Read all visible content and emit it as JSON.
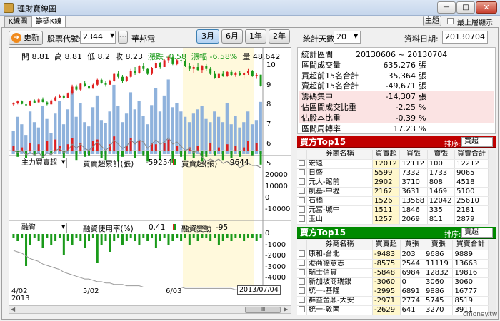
{
  "window": {
    "title": "理財寶線圖",
    "btn_theme": "主題",
    "always_on_top": "最上層顯示",
    "min": "—",
    "max": "□",
    "close": "✕"
  },
  "tabs": [
    "K線圖",
    "籌碼K線圖"
  ],
  "toolbar": {
    "refresh": "更新",
    "stock_code_label": "股票代號:",
    "stock_code": "2344",
    "stock_name": "華邦電",
    "periods": [
      "3月",
      "6月",
      "1年",
      "2年"
    ],
    "days_label": "統計天數:",
    "days_value": "20",
    "date_label": "資料日期:",
    "date_value": "20130704"
  },
  "ohlc": {
    "open_label": "開",
    "open": "8.81",
    "high_label": "高",
    "high": "8.81",
    "low_label": "低",
    "low": "8.2",
    "close_label": "收",
    "close": "8.23",
    "chg_label": "漲跌",
    "chg": "-0.58",
    "pct_label": "漲幅",
    "pct": "-6.58%",
    "vol_label": "量",
    "vol": "48,642"
  },
  "price_axis": [
    "10",
    "9",
    "8",
    "7",
    "6",
    "5"
  ],
  "panel2": {
    "select": "主力買賣超",
    "cum_label": "買賣超累計(張)",
    "cum_val": "-59254",
    "net_label": "買賣超(張)",
    "net_val": "-9644",
    "axis": [
      "20000",
      "10000",
      "0",
      "-10000"
    ]
  },
  "panel3": {
    "select": "融資",
    "use_label": "融資使用率(%)",
    "use_val": "0.41",
    "chg_label": "融資變動",
    "chg_val": "-95",
    "axis": [
      "0",
      "-1000",
      "-2000",
      "-3000",
      "-4000"
    ]
  },
  "xaxis": {
    "labels": [
      "4/02",
      "5/02",
      "6/03"
    ],
    "year": "2013",
    "cursor": "2013/07/04"
  },
  "stats": [
    {
      "label": "統計區間",
      "value": "20130606 ~ 20130704",
      "unit": ""
    },
    {
      "label": "區間成交量",
      "value": "635,276",
      "unit": "張"
    },
    {
      "label": "買超前15名合計",
      "value": "35,364",
      "unit": "張"
    },
    {
      "label": "賣超前15名合計",
      "value": "-49,671",
      "unit": "張"
    },
    {
      "label": "籌碼集中",
      "value": "-14,307",
      "unit": "張"
    },
    {
      "label": "佔區間成交比重",
      "value": "-2.25",
      "unit": "%"
    },
    {
      "label": "佔股本比重",
      "value": "-0.39",
      "unit": "%"
    },
    {
      "label": "區間周轉率",
      "value": "17.23",
      "unit": "%"
    }
  ],
  "buy_panel": {
    "title": "買方Top15",
    "sort_label": "排序:",
    "sort_value": "買超",
    "headers": [
      "券商名稱",
      "買賣超",
      "買張",
      "賣張",
      "買賣合計"
    ],
    "rows": [
      [
        "宏遠",
        "12012",
        "12112",
        "100",
        "12212"
      ],
      [
        "日盛",
        "5599",
        "7332",
        "1733",
        "9065"
      ],
      [
        "元大-館前",
        "2902",
        "3710",
        "808",
        "4518"
      ],
      [
        "凱基-中壢",
        "2162",
        "3631",
        "1469",
        "5100"
      ],
      [
        "石橋",
        "1526",
        "13568",
        "12042",
        "25610"
      ],
      [
        "元富-城中",
        "1511",
        "1846",
        "335",
        "2181"
      ],
      [
        "玉山",
        "1257",
        "2069",
        "811",
        "2879"
      ]
    ]
  },
  "sell_panel": {
    "title": "賣方Top15",
    "sort_label": "排序:",
    "sort_value": "賣超",
    "headers": [
      "券商名稱",
      "買賣超",
      "買張",
      "賣張",
      "買賣合計"
    ],
    "rows": [
      [
        "康和-台北",
        "-9483",
        "203",
        "9686",
        "9889"
      ],
      [
        "港商德意志",
        "-8575",
        "2544",
        "11119",
        "13663"
      ],
      [
        "瑞士信貸",
        "-5848",
        "6984",
        "12832",
        "19816"
      ],
      [
        "新加坡商瑞銀",
        "-3060",
        "0",
        "3060",
        "3060"
      ],
      [
        "統一-基隆",
        "-2995",
        "6891",
        "9886",
        "16777"
      ],
      [
        "群益金鼎-大安",
        "-2971",
        "2774",
        "5745",
        "8519"
      ],
      [
        "統一-敦南",
        "-2629",
        "641",
        "3270",
        "3911"
      ]
    ]
  },
  "watermark": "cmoney.tw",
  "colors": {
    "up": "#e02020",
    "down": "#1a9a1a",
    "bar": "#8fb2dc",
    "buy_header": "#c00000",
    "sell_header": "#008a00",
    "highlight": "#fff9dc"
  },
  "prices": [
    [
      7.3,
      7.4,
      7.2,
      7.35
    ],
    [
      7.35,
      7.5,
      7.3,
      7.45
    ],
    [
      7.45,
      7.5,
      7.3,
      7.32
    ],
    [
      7.3,
      7.4,
      7.2,
      7.25
    ],
    [
      7.25,
      7.5,
      7.2,
      7.48
    ],
    [
      7.5,
      7.55,
      7.35,
      7.38
    ],
    [
      7.4,
      7.6,
      7.35,
      7.55
    ],
    [
      7.55,
      7.65,
      7.4,
      7.42
    ],
    [
      7.4,
      7.45,
      7.25,
      7.3
    ],
    [
      7.3,
      7.55,
      7.3,
      7.5
    ],
    [
      7.5,
      7.7,
      7.45,
      7.65
    ],
    [
      7.65,
      7.8,
      7.6,
      7.75
    ],
    [
      7.75,
      7.8,
      7.55,
      7.6
    ],
    [
      7.6,
      7.9,
      7.6,
      7.85
    ],
    [
      7.85,
      8.3,
      7.8,
      8.2
    ],
    [
      8.2,
      8.3,
      8.0,
      8.05
    ],
    [
      8.05,
      8.4,
      8.0,
      8.35
    ],
    [
      8.35,
      8.5,
      8.2,
      8.25
    ],
    [
      8.25,
      8.3,
      8.05,
      8.1
    ],
    [
      8.1,
      8.35,
      8.1,
      8.3
    ],
    [
      8.3,
      8.6,
      8.25,
      8.55
    ],
    [
      8.55,
      8.6,
      8.35,
      8.4
    ],
    [
      8.4,
      8.5,
      8.2,
      8.3
    ],
    [
      8.3,
      8.55,
      8.3,
      8.5
    ],
    [
      8.5,
      8.9,
      8.45,
      8.85
    ],
    [
      8.85,
      9.0,
      8.6,
      8.7
    ],
    [
      8.7,
      8.8,
      8.4,
      8.5
    ],
    [
      8.5,
      8.75,
      8.45,
      8.7
    ],
    [
      8.7,
      9.1,
      8.65,
      9.0
    ],
    [
      9.0,
      9.2,
      8.8,
      8.9
    ],
    [
      8.9,
      9.3,
      8.85,
      9.25
    ],
    [
      9.25,
      9.4,
      9.0,
      9.1
    ],
    [
      9.1,
      9.15,
      8.8,
      8.85
    ],
    [
      8.85,
      9.2,
      8.8,
      9.15
    ],
    [
      9.15,
      9.5,
      9.1,
      9.4
    ],
    [
      9.4,
      9.45,
      9.1,
      9.2
    ],
    [
      9.2,
      9.6,
      9.2,
      9.55
    ],
    [
      9.55,
      9.8,
      9.4,
      9.7
    ],
    [
      9.7,
      9.75,
      9.3,
      9.35
    ],
    [
      9.35,
      9.6,
      9.3,
      9.55
    ],
    [
      9.55,
      9.7,
      9.4,
      9.5
    ],
    [
      9.5,
      9.6,
      9.2,
      9.25
    ],
    [
      9.25,
      9.4,
      9.0,
      9.1
    ],
    [
      9.1,
      9.3,
      8.9,
      9.2
    ],
    [
      9.2,
      9.4,
      9.0,
      9.05
    ],
    [
      9.05,
      9.3,
      8.9,
      9.25
    ],
    [
      9.25,
      9.35,
      9.0,
      9.1
    ],
    [
      9.1,
      9.2,
      8.8,
      8.85
    ],
    [
      8.85,
      9.0,
      8.6,
      8.65
    ],
    [
      8.65,
      8.9,
      8.6,
      8.85
    ],
    [
      8.85,
      9.0,
      8.7,
      8.75
    ],
    [
      8.75,
      9.0,
      8.7,
      8.95
    ],
    [
      8.95,
      9.05,
      8.75,
      8.8
    ],
    [
      8.8,
      8.95,
      8.7,
      8.9
    ],
    [
      8.9,
      9.0,
      8.75,
      8.8
    ],
    [
      8.8,
      8.95,
      8.6,
      8.9
    ],
    [
      8.9,
      9.1,
      8.8,
      9.0
    ],
    [
      9.0,
      9.05,
      8.7,
      8.75
    ],
    [
      8.75,
      8.9,
      8.6,
      8.8
    ],
    [
      8.81,
      8.81,
      8.2,
      8.23
    ]
  ],
  "volumes": [
    22,
    35,
    28,
    18,
    40,
    30,
    25,
    45,
    33,
    20,
    38,
    50,
    28,
    42,
    60,
    35,
    48,
    30,
    26,
    44,
    55,
    32,
    29,
    40,
    65,
    45,
    30,
    38,
    58,
    42,
    50,
    36,
    28,
    46,
    62,
    40,
    55,
    70,
    44,
    48,
    40,
    35,
    30,
    38,
    42,
    45,
    33,
    30,
    40,
    35,
    30,
    48,
    28,
    36,
    25,
    30,
    40,
    28,
    32,
    49
  ],
  "net_bars": [
    3,
    -4,
    2,
    -6,
    5,
    -3,
    4,
    -8,
    6,
    -2,
    7,
    3,
    -5,
    4,
    8,
    -6,
    5,
    -4,
    -3,
    6,
    7,
    -5,
    -6,
    4,
    9,
    -7,
    -4,
    3,
    8,
    -5,
    6,
    -3,
    -7,
    5,
    4,
    -6,
    5,
    7,
    -8,
    3,
    -4,
    -6,
    2,
    -5,
    3,
    -7,
    -4,
    5,
    -3,
    2,
    -6,
    4,
    -5,
    3,
    -4,
    2,
    6,
    -3,
    5,
    -9
  ],
  "cum_line": [
    0,
    -1,
    0,
    -2,
    -1,
    -2,
    -1,
    -3,
    -1,
    -2,
    0,
    1,
    -1,
    0,
    3,
    1,
    3,
    1,
    0,
    2,
    4,
    2,
    0,
    2,
    5,
    3,
    1,
    2,
    5,
    3,
    5,
    4,
    1,
    3,
    5,
    3,
    4,
    6,
    3,
    4,
    2,
    0,
    1,
    -1,
    0,
    -3,
    -5,
    -4,
    -5,
    -4,
    -6,
    -5,
    -7,
    -6,
    -8,
    -7,
    -6,
    -7,
    -7,
    -8
  ],
  "margin_bars": [
    -1,
    -2,
    -1,
    -9,
    -3,
    -1,
    -2,
    -4,
    -1,
    -3,
    -2,
    -1,
    -6,
    -2,
    -3,
    -1,
    -2,
    -4,
    -2,
    -1,
    -8,
    -3,
    -2,
    -5,
    -2,
    -1,
    -3,
    -2,
    -1,
    -2,
    -3,
    -1,
    -2,
    -1,
    -4,
    -2,
    -1,
    -3,
    -2,
    -1,
    -2,
    -1,
    -3,
    -1,
    -2,
    -1,
    -1,
    -2,
    -1,
    -3,
    -2,
    -1,
    -2,
    -1,
    -1,
    -2,
    -1,
    -1,
    -2,
    -1
  ],
  "margin_line": [
    -8,
    -9,
    -10,
    -12,
    -14,
    -15,
    -16,
    -18,
    -19,
    -20,
    -21,
    -22,
    -24,
    -25,
    -26,
    -27,
    -28,
    -29,
    -29,
    -30,
    -31,
    -31,
    -32,
    -32,
    -33,
    -33,
    -33,
    -34,
    -34,
    -34,
    -34,
    -35,
    -35,
    -35,
    -35,
    -35,
    -35,
    -35,
    -35,
    -35,
    -35,
    -36,
    -36,
    -36,
    -36,
    -36,
    -36,
    -36,
    -36,
    -36,
    -36,
    -36,
    -36,
    -37,
    -37,
    -37,
    -37,
    -37,
    -37,
    -37
  ]
}
